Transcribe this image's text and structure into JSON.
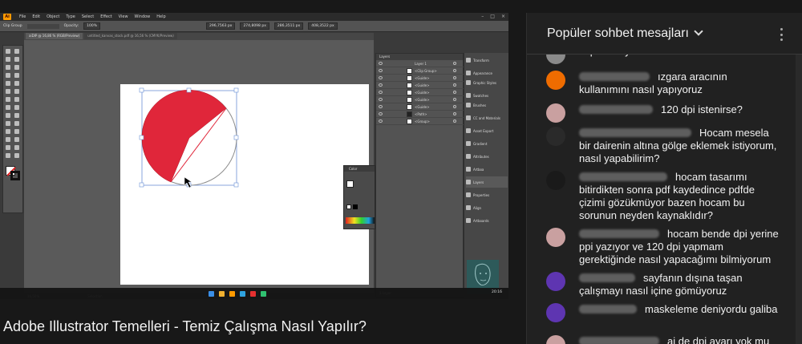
{
  "video": {
    "ai_menu": [
      "File",
      "Edit",
      "Object",
      "Type",
      "Select",
      "Effect",
      "View",
      "Window",
      "Help"
    ],
    "ai_logo": "Ai",
    "control_bar": {
      "mode": "Clip Group",
      "opacity_label": "Opacity:",
      "opacity_value": "100%",
      "x_value": "296,7563 px",
      "y_value": "274,8098 px",
      "w_value": "286,3511 px",
      "h_value": "408,3522 px"
    },
    "doc_tabs": [
      "aiDIP @ 16,86 % (RGB/Preview)",
      "untitled_kanvas_stock.pdf @ 16,56 % (CMYK/Preview)"
    ],
    "layers": {
      "header": "Layers",
      "rows": [
        "Layer 1",
        "<Clip Group>",
        "<Guide>",
        "<Guide>",
        "<Guide>",
        "<Guide>",
        "<Guide>",
        "<Path>",
        "<Group>"
      ],
      "footer": "1 Layer"
    },
    "color_panel_title": "Color",
    "dock_items": [
      "Transform",
      "Appearance",
      "Graphic Styles",
      "Swatches",
      "Brushes",
      "CC and Materials",
      "Asset Export",
      "Gradient",
      "Attributes",
      "Artboa",
      "Layers",
      "Properties",
      "Align",
      "Artboards"
    ],
    "status": {
      "zoom": "16,56%",
      "selection": "Selection"
    },
    "clock": "20:16"
  },
  "title": "Adobe Illustrator Temelleri - Temiz Çalışma Nasıl Yapılır?",
  "chat": {
    "header": "Popüler sohbet mesajları",
    "messages": [
      {
        "text": "export ediyoruz",
        "avatar_color": "#8a8a8a",
        "author_w": 0
      },
      {
        "text": "ızgara aracının kullanımını nasıl yapıyoruz",
        "avatar_color": "#ef6c00",
        "author_w": 88
      },
      {
        "text": "120 dpi istenirse?",
        "avatar_color": "#c9a0a0",
        "author_w": 92
      },
      {
        "text": "Hocam mesela bir dairenin altına gölge eklemek istiyorum, nasıl yapabilirim?",
        "avatar_color": "#2a2a2a",
        "author_w": 140
      },
      {
        "text": "hocam tasarımı bitirdikten sonra pdf kaydedince pdfde çizimi gözükmüyor bazen hocam bu sorunun neyden kaynaklıdır?",
        "avatar_color": "#1a1a1a",
        "author_w": 110
      },
      {
        "text": "hocam bende dpi yerine ppi yazıyor ve 120 dpi yapmam gerektiğinde nasıl yapacağımı bilmiyorum",
        "avatar_color": "#c9a0a0",
        "author_w": 100
      },
      {
        "text": "sayfanın dışına taşan çalışmayı nasıl içine gömüyoruz",
        "avatar_color": "#5e35b1",
        "author_w": 70
      },
      {
        "text": "maskeleme deniyordu galiba",
        "avatar_color": "#5e35b1",
        "author_w": 72
      },
      {
        "text": "ai de dpi ayarı yok mu",
        "avatar_color": "#c9a0a0",
        "author_w": 100
      }
    ]
  }
}
